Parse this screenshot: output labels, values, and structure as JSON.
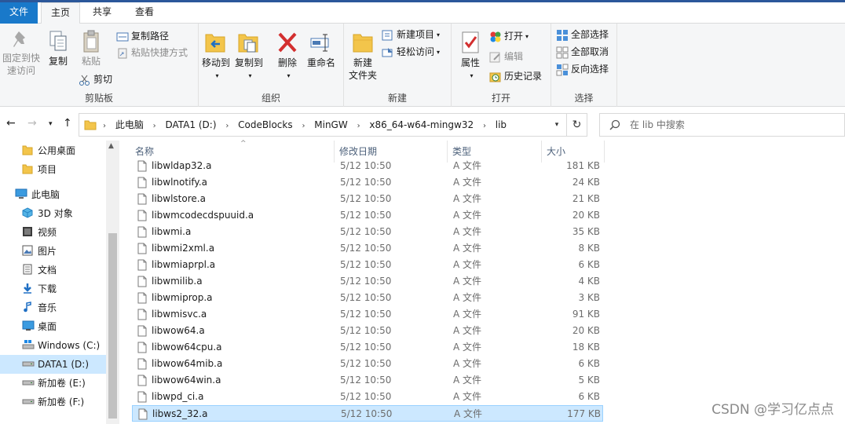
{
  "ribbon_tabs": {
    "file": "文件",
    "home": "主页",
    "share": "共享",
    "view": "查看"
  },
  "clipboard": {
    "pin_line1": "固定到快",
    "pin_line2": "速访问",
    "copy": "复制",
    "paste": "粘贴",
    "copy_path": "复制路径",
    "paste_shortcut": "粘贴快捷方式",
    "cut": "剪切",
    "label": "剪贴板"
  },
  "organize": {
    "move_to": "移动到",
    "copy_to": "复制到",
    "delete": "删除",
    "rename": "重命名",
    "label": "组织"
  },
  "new_group": {
    "new_folder_line1": "新建",
    "new_folder_line2": "文件夹",
    "new_item": "新建项目",
    "easy_access": "轻松访问",
    "label": "新建"
  },
  "open_group": {
    "properties": "属性",
    "open": "打开",
    "edit": "编辑",
    "history": "历史记录",
    "label": "打开"
  },
  "select_group": {
    "select_all": "全部选择",
    "select_none": "全部取消",
    "invert": "反向选择",
    "label": "选择"
  },
  "breadcrumb": [
    "此电脑",
    "DATA1 (D:)",
    "CodeBlocks",
    "MinGW",
    "x86_64-w64-mingw32",
    "lib"
  ],
  "search": {
    "placeholder": "在 lib 中搜索"
  },
  "nav_pane": [
    {
      "label": "公用桌面",
      "icon": "folder-icon"
    },
    {
      "label": "项目",
      "icon": "folder-icon"
    },
    {
      "label": "此电脑",
      "icon": "computer-icon"
    },
    {
      "label": "3D 对象",
      "icon": "cube-3d-icon"
    },
    {
      "label": "视频",
      "icon": "video-icon"
    },
    {
      "label": "图片",
      "icon": "picture-icon"
    },
    {
      "label": "文档",
      "icon": "document-icon"
    },
    {
      "label": "下载",
      "icon": "download-icon"
    },
    {
      "label": "音乐",
      "icon": "music-icon"
    },
    {
      "label": "桌面",
      "icon": "desktop-icon"
    },
    {
      "label": "Windows (C:)",
      "icon": "windows-drive-icon"
    },
    {
      "label": "DATA1 (D:)",
      "icon": "drive-icon"
    },
    {
      "label": "新加卷 (E:)",
      "icon": "drive-icon"
    },
    {
      "label": "新加卷 (F:)",
      "icon": "drive-icon"
    }
  ],
  "columns": {
    "name": "名称",
    "date": "修改日期",
    "type": "类型",
    "size": "大小"
  },
  "files": [
    {
      "name": "libwldap32.a",
      "date": "5/12 10:50",
      "type": "A 文件",
      "size": "181 KB"
    },
    {
      "name": "libwlnotify.a",
      "date": "5/12 10:50",
      "type": "A 文件",
      "size": "24 KB"
    },
    {
      "name": "libwlstore.a",
      "date": "5/12 10:50",
      "type": "A 文件",
      "size": "21 KB"
    },
    {
      "name": "libwmcodecdspuuid.a",
      "date": "5/12 10:50",
      "type": "A 文件",
      "size": "20 KB"
    },
    {
      "name": "libwmi.a",
      "date": "5/12 10:50",
      "type": "A 文件",
      "size": "35 KB"
    },
    {
      "name": "libwmi2xml.a",
      "date": "5/12 10:50",
      "type": "A 文件",
      "size": "8 KB"
    },
    {
      "name": "libwmiaprpl.a",
      "date": "5/12 10:50",
      "type": "A 文件",
      "size": "6 KB"
    },
    {
      "name": "libwmilib.a",
      "date": "5/12 10:50",
      "type": "A 文件",
      "size": "4 KB"
    },
    {
      "name": "libwmiprop.a",
      "date": "5/12 10:50",
      "type": "A 文件",
      "size": "3 KB"
    },
    {
      "name": "libwmisvc.a",
      "date": "5/12 10:50",
      "type": "A 文件",
      "size": "91 KB"
    },
    {
      "name": "libwow64.a",
      "date": "5/12 10:50",
      "type": "A 文件",
      "size": "20 KB"
    },
    {
      "name": "libwow64cpu.a",
      "date": "5/12 10:50",
      "type": "A 文件",
      "size": "18 KB"
    },
    {
      "name": "libwow64mib.a",
      "date": "5/12 10:50",
      "type": "A 文件",
      "size": "6 KB"
    },
    {
      "name": "libwow64win.a",
      "date": "5/12 10:50",
      "type": "A 文件",
      "size": "5 KB"
    },
    {
      "name": "libwpd_ci.a",
      "date": "5/12 10:50",
      "type": "A 文件",
      "size": "6 KB"
    },
    {
      "name": "libws2_32.a",
      "date": "5/12 10:50",
      "type": "A 文件",
      "size": "177 KB"
    }
  ],
  "selected_file": "libws2_32.a",
  "selected_nav": "DATA1 (D:)",
  "watermark": "CSDN @学习亿点点",
  "colors": {
    "accent": "#1979ca",
    "selection": "#cce8ff",
    "folder": "#f3c54b",
    "delete_red": "#d32f2f"
  }
}
